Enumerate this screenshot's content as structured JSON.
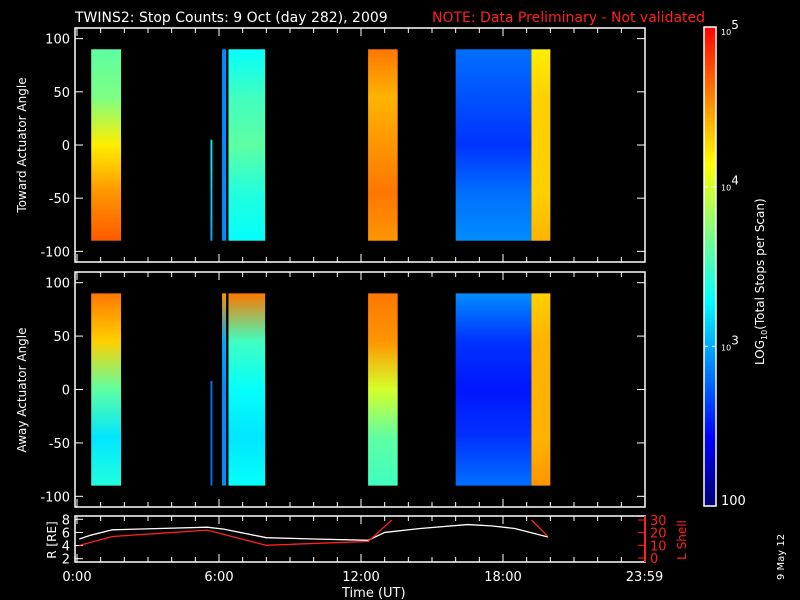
{
  "title": {
    "main": "TWINS2: Stop Counts:  9 Oct (day 282), 2009",
    "note": "NOTE: Data Preliminary - Not validated",
    "note_color": "#ff2020"
  },
  "footer_date": "9 May 12",
  "chart_data": [
    {
      "type": "heatmap",
      "name": "toward",
      "ylabel": "Toward Actuator Angle",
      "ylim": [
        -110,
        110
      ],
      "yticks": [
        100,
        50,
        0,
        -50,
        -100
      ],
      "xlim": [
        0,
        24
      ],
      "value_units": "log10 counts",
      "blocks": [
        {
          "t0": 0.6,
          "t1": 1.86,
          "a0": 90,
          "a1": -90,
          "profile": [
            3.6,
            3.7,
            4.2,
            4.5,
            4.7
          ]
        },
        {
          "t0": 5.64,
          "t1": 5.72,
          "a0": 5,
          "a1": -90,
          "profile": [
            3.2,
            3.2,
            3.1,
            3.1,
            3.0
          ]
        },
        {
          "t0": 6.13,
          "t1": 6.3,
          "a0": 90,
          "a1": -90,
          "profile": [
            2.9,
            2.9,
            2.9,
            2.9,
            2.9
          ]
        },
        {
          "t0": 6.4,
          "t1": 7.95,
          "a0": 90,
          "a1": -90,
          "profile": [
            3.3,
            3.5,
            3.6,
            3.4,
            3.3
          ]
        },
        {
          "t0": 12.3,
          "t1": 13.55,
          "a0": 90,
          "a1": -90,
          "profile": [
            4.6,
            4.4,
            4.5,
            4.6,
            4.5
          ]
        },
        {
          "t0": 16.0,
          "t1": 19.2,
          "a0": 90,
          "a1": -90,
          "profile": [
            2.8,
            2.7,
            2.6,
            2.8,
            2.9
          ]
        },
        {
          "t0": 19.2,
          "t1": 20.0,
          "a0": 90,
          "a1": -90,
          "profile": [
            4.2,
            4.3,
            4.3,
            4.3,
            4.4
          ]
        }
      ]
    },
    {
      "type": "heatmap",
      "name": "away",
      "ylabel": "Away Actuator Angle",
      "ylim": [
        -110,
        110
      ],
      "yticks": [
        100,
        50,
        0,
        -50,
        -100
      ],
      "xlim": [
        0,
        24
      ],
      "value_units": "log10 counts",
      "blocks": [
        {
          "t0": 0.6,
          "t1": 1.86,
          "a0": 90,
          "a1": -90,
          "profile": [
            4.6,
            4.3,
            3.6,
            3.2,
            3.4
          ]
        },
        {
          "t0": 5.64,
          "t1": 5.72,
          "a0": 8,
          "a1": -90,
          "profile": [
            2.8,
            2.8,
            2.8,
            2.8,
            2.8
          ]
        },
        {
          "t0": 6.13,
          "t1": 6.3,
          "a0": 90,
          "a1": -90,
          "profile": [
            4.5,
            3.0,
            2.9,
            2.9,
            2.9
          ]
        },
        {
          "t0": 6.4,
          "t1": 7.95,
          "a0": 90,
          "a1": -90,
          "profile": [
            4.6,
            3.5,
            3.3,
            3.2,
            3.3
          ]
        },
        {
          "t0": 12.3,
          "t1": 13.55,
          "a0": 90,
          "a1": -90,
          "profile": [
            4.6,
            4.5,
            4.0,
            3.6,
            3.5
          ]
        },
        {
          "t0": 16.0,
          "t1": 19.2,
          "a0": 90,
          "a1": -90,
          "profile": [
            2.9,
            2.6,
            2.5,
            2.6,
            2.8
          ]
        },
        {
          "t0": 19.2,
          "t1": 20.0,
          "a0": 90,
          "a1": -90,
          "profile": [
            4.3,
            4.4,
            4.4,
            4.4,
            4.5
          ]
        }
      ]
    },
    {
      "type": "line",
      "name": "ephemeris",
      "ylabel_left": "R [RE]",
      "ylabel_right": "L Shell",
      "ylim_left": [
        1.5,
        8.5
      ],
      "ylim_right": [
        0,
        30
      ],
      "yticks_left": [
        2,
        4,
        6,
        8
      ],
      "yticks_right": [
        0,
        10,
        20,
        30
      ],
      "xlabel": "Time (UT)",
      "xticks": [
        {
          "t": 0,
          "label": "0:00"
        },
        {
          "t": 6,
          "label": "6:00"
        },
        {
          "t": 12,
          "label": "12:00"
        },
        {
          "t": 18,
          "label": "18:00"
        },
        {
          "t": 23.98,
          "label": "23:59"
        }
      ],
      "series": [
        {
          "name": "R",
          "color": "#ffffff",
          "axis": "left",
          "points": [
            [
              0.1,
              5.0
            ],
            [
              0.6,
              5.6
            ],
            [
              1.5,
              6.4
            ],
            [
              3.5,
              6.6
            ],
            [
              5.5,
              6.8
            ],
            [
              6.2,
              6.5
            ],
            [
              8.0,
              5.2
            ],
            [
              10.0,
              5.0
            ],
            [
              12.3,
              4.8
            ],
            [
              13.0,
              6.0
            ],
            [
              14.5,
              6.6
            ],
            [
              16.5,
              7.2
            ],
            [
              17.5,
              7.0
            ],
            [
              18.5,
              6.6
            ],
            [
              19.9,
              5.3
            ]
          ]
        },
        {
          "name": "L",
          "color": "#ff2020",
          "axis": "right",
          "segments": [
            [
              [
                0.1,
                10
              ],
              [
                1.5,
                17
              ],
              [
                3.5,
                19.5
              ],
              [
                5.5,
                22
              ],
              [
                8.0,
                10
              ],
              [
                10.0,
                11.5
              ],
              [
                12.3,
                13
              ],
              [
                13.3,
                30
              ]
            ],
            [
              [
                19.2,
                30
              ],
              [
                19.9,
                17
              ]
            ]
          ]
        }
      ]
    }
  ],
  "colorbar": {
    "label": "LOG10(Total Stops per Scan)",
    "label_main": "LOG",
    "label_sub": "10",
    "label_rest": "(Total Stops per Scan)",
    "range_log": [
      2,
      5
    ],
    "ticks": [
      {
        "v": 5,
        "base": "10",
        "exp": "5"
      },
      {
        "v": 4,
        "base": "10",
        "exp": "4"
      },
      {
        "v": 3,
        "base": "10",
        "exp": "3"
      },
      {
        "v": 2,
        "base": "100",
        "exp": ""
      }
    ],
    "colors": [
      "#000070",
      "#0000ff",
      "#0080ff",
      "#00ffff",
      "#80ff80",
      "#ffff00",
      "#ff8000",
      "#ff0000"
    ]
  }
}
